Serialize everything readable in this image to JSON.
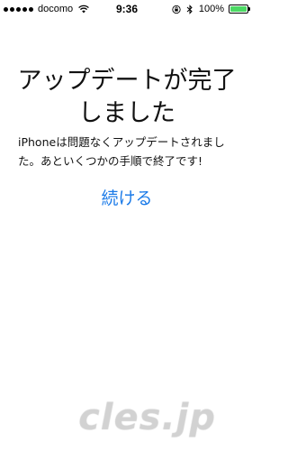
{
  "status_bar": {
    "carrier": "docomo",
    "time": "9:36",
    "battery_percent": "100%",
    "battery_level": 1.0,
    "battery_color": "#4cd964",
    "signal_bars": 5,
    "icons": [
      "wifi-icon",
      "orientation-lock-icon",
      "bluetooth-icon",
      "battery-icon"
    ]
  },
  "update_complete": {
    "title_line1": "アップデートが完了",
    "title_line2": "しました",
    "message_line1": "iPhoneは問題なくアップデートされまし",
    "message_line2": "た。あといくつかの手順で終了です!",
    "continue_label": "続ける",
    "accent_color": "#1a7ae8"
  },
  "watermark": {
    "text": "cles.jp"
  }
}
